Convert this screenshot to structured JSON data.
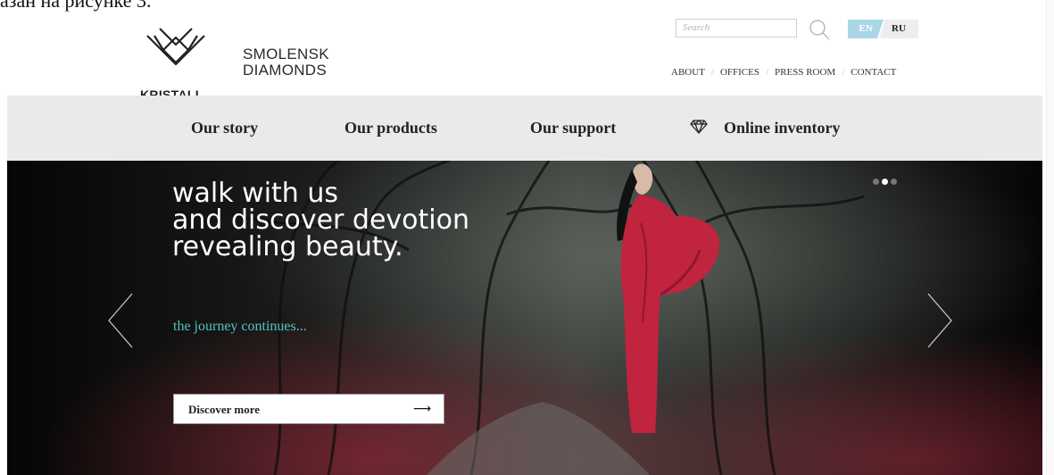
{
  "caption": "азан на рисунке 3.",
  "header": {
    "logo_text": "KRISTALL",
    "brand_line1": "SMOLENSK",
    "brand_line2": "DIAMONDS",
    "search_placeholder": "Search",
    "lang_en": "EN",
    "lang_ru": "RU",
    "topnav": [
      "ABOUT",
      "OFFICES",
      "PRESS ROOM",
      "CONTACT"
    ]
  },
  "mainnav": {
    "items": [
      "Our story",
      "Our products",
      "Our support",
      "Online inventory"
    ]
  },
  "hero": {
    "title": "walk with us\nand discover devotion\nrevealing beauty.",
    "subtitle": "the journey continues...",
    "cta_label": "Discover more",
    "cta_arrow": "⟶",
    "slide_count": 3,
    "active_slide": 2
  },
  "colors": {
    "accent_teal": "#4fc6c0",
    "lang_active": "#aad6e5",
    "nav_bg": "#eaeaea",
    "dress_red": "#c0243f"
  },
  "icons": [
    "kristall-crown-icon",
    "search-icon",
    "diamond-icon",
    "chevron-left-icon",
    "chevron-right-icon",
    "arrow-right-icon"
  ]
}
